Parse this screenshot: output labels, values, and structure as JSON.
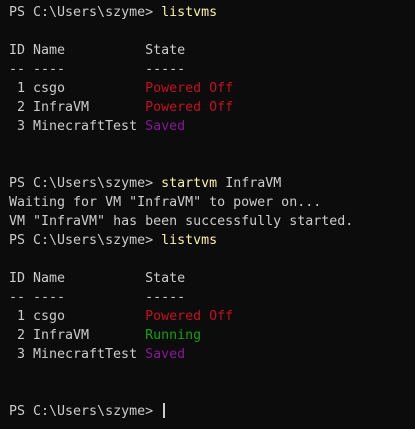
{
  "prompt": "PS C:\\Users\\szyme>",
  "block1": {
    "command": "listvms",
    "header": {
      "id": "ID",
      "name": "Name",
      "state": "State"
    },
    "underline": {
      "id": "--",
      "name": "----",
      "state": "-----"
    },
    "rows": [
      {
        "id": "1",
        "name": "csgo",
        "state": "Powered Off"
      },
      {
        "id": "2",
        "name": "InfraVM",
        "state": "Powered Off"
      },
      {
        "id": "3",
        "name": "MinecraftTest",
        "state": "Saved"
      }
    ]
  },
  "block2": {
    "command": "startvm",
    "argument": "InfraVM",
    "output": [
      "Waiting for VM \"InfraVM\" to power on...",
      "VM \"InfraVM\" has been successfully started."
    ]
  },
  "block3": {
    "command": "listvms",
    "header": {
      "id": "ID",
      "name": "Name",
      "state": "State"
    },
    "underline": {
      "id": "--",
      "name": "----",
      "state": "-----"
    },
    "rows": [
      {
        "id": "1",
        "name": "csgo",
        "state": "Powered Off"
      },
      {
        "id": "2",
        "name": "InfraVM",
        "state": "Running"
      },
      {
        "id": "3",
        "name": "MinecraftTest",
        "state": "Saved"
      }
    ]
  },
  "colors": {
    "background": "#0c0c0c",
    "text": "#cccccc",
    "command": "#f9f1a5",
    "powered_off": "#c50f1f",
    "running": "#13a10e",
    "saved": "#881798"
  }
}
